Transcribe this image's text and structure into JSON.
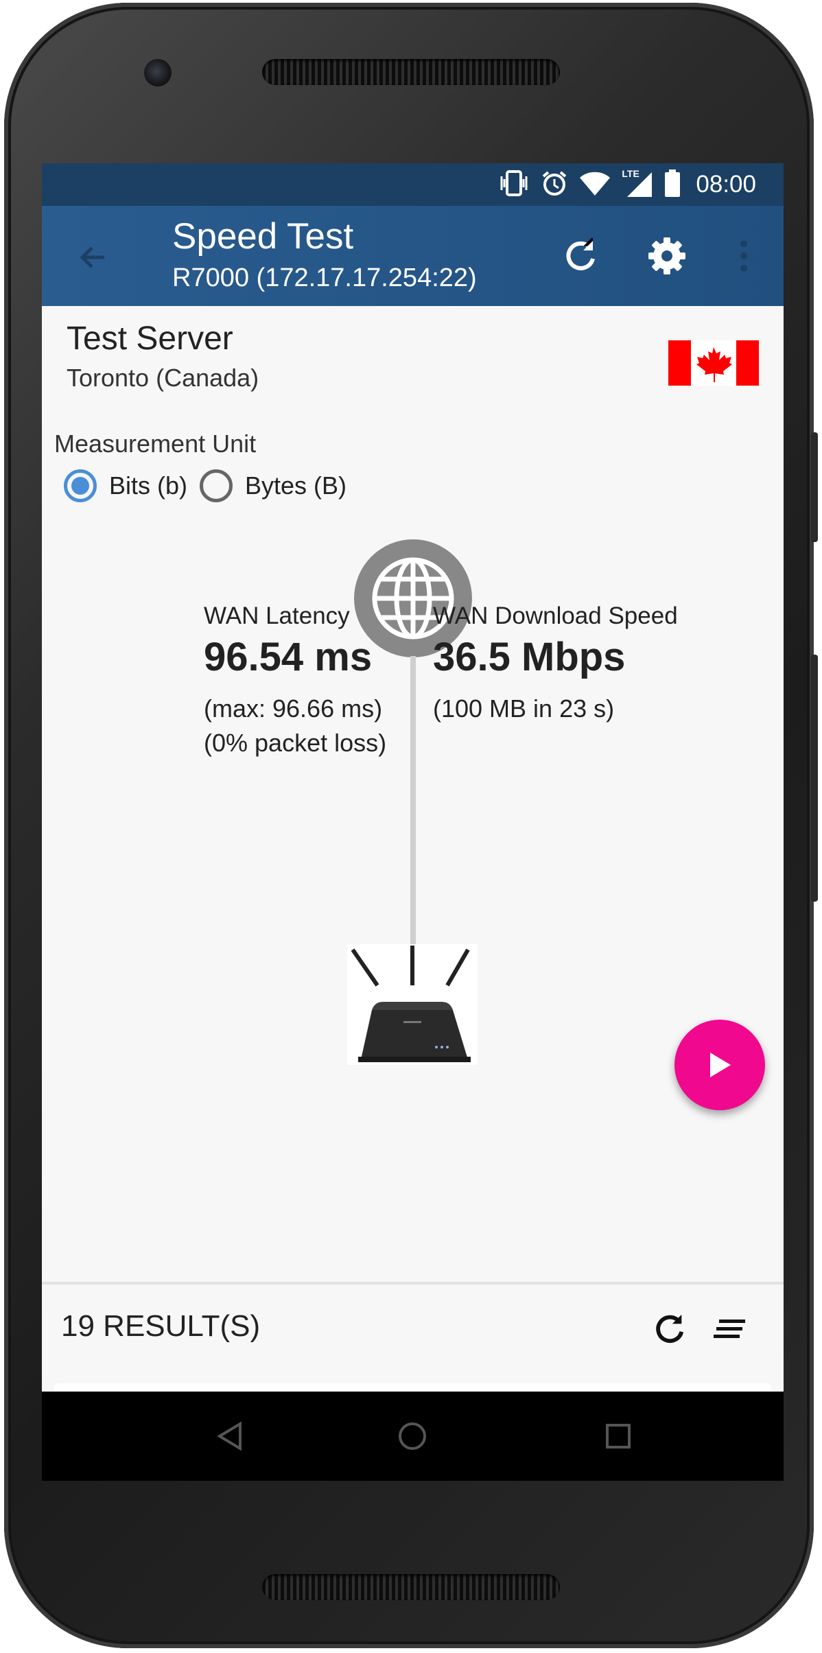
{
  "status_bar": {
    "time": "08:00",
    "icons": [
      "vibrate-icon",
      "alarm-icon",
      "wifi-icon",
      "lte-signal-icon",
      "battery-icon"
    ],
    "network_label": "LTE"
  },
  "app_bar": {
    "title": "Speed Test",
    "subtitle": "R7000 (172.17.17.254:22)",
    "icons": [
      "back-arrow-icon",
      "refresh-icon",
      "settings-gear-icon",
      "more-vert-icon"
    ]
  },
  "server": {
    "title": "Test Server",
    "location": "Toronto (Canada)",
    "flag_icon": "canada-flag-icon"
  },
  "measurement": {
    "label": "Measurement Unit",
    "options": [
      {
        "label": "Bits (b)",
        "selected": true
      },
      {
        "label": "Bytes (B)",
        "selected": false
      }
    ]
  },
  "latency": {
    "label": "WAN Latency",
    "value": "96.54 ms",
    "max": "(max: 96.66 ms)",
    "loss": "(0% packet loss)"
  },
  "download": {
    "label": "WAN Download Speed",
    "value": "36.5 Mbps",
    "detail": "(100 MB in 23 s)"
  },
  "fab_icon": "play-icon",
  "results": {
    "count_label": "19 RESULT(S)",
    "icons": [
      "refresh-icon",
      "sort-icon"
    ]
  },
  "nav": {
    "icons": [
      "back-triangle-icon",
      "home-circle-icon",
      "recents-square-icon"
    ]
  },
  "colors": {
    "status_bar": "#1c3f64",
    "app_bar": "#2a5c90",
    "accent": "#4a8ed8",
    "fab": "#f0088f",
    "canada_red": "#ff0000"
  }
}
